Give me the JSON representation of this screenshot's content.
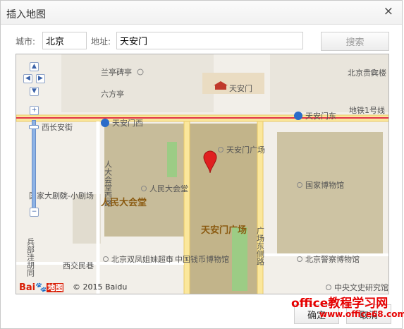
{
  "dialog": {
    "title": "插入地图",
    "close": "×"
  },
  "form": {
    "city_label": "城市:",
    "city_value": "北京",
    "address_label": "地址:",
    "address_value": "天安门",
    "search_button": "搜索"
  },
  "map": {
    "labels": {
      "lanting": "兰亭碑亭",
      "liufang": "六方亭",
      "tiananmen": "天安门",
      "beijing_guibin": "北京贵宾楼",
      "tiananmen_west": "天安门西",
      "tiananmen_east": "天安门东",
      "west_changan": "西长安街",
      "line1": "地铁1号线",
      "renda_west": "人大会堂西路",
      "renmin_dahuitang": "人民大会堂",
      "renmin_dahuitang_bold": "人民大会堂",
      "tam_square": "天安门广场",
      "tam_square_bold": "天安门广场",
      "national_museum": "国家博物馆",
      "national_theatre": "国家大剧院-小剧场",
      "tam_east_road": "广场东侧路",
      "bingbu": "兵部洼胡同",
      "xijiaomin": "西交民巷",
      "shuangfeng": "北京双凤姐妹超市",
      "coin_museum": "中国钱币博物馆",
      "police_museum": "北京警察博物馆",
      "wenshi": "中央文史研究馆"
    },
    "copyright": "© 2015 Baidu",
    "logo": {
      "bai": "Bai",
      "paw": "🐾",
      "tu": "地图"
    },
    "colors": {
      "avenue": "#fbe79b",
      "subway": "#e0334a",
      "square": "#c2b48a",
      "green": "#9ccc85"
    }
  },
  "footer": {
    "confirm": "确定",
    "cancel": "取消"
  },
  "watermark": {
    "line1": "office教程学习网",
    "line2": "www.office68.com"
  }
}
